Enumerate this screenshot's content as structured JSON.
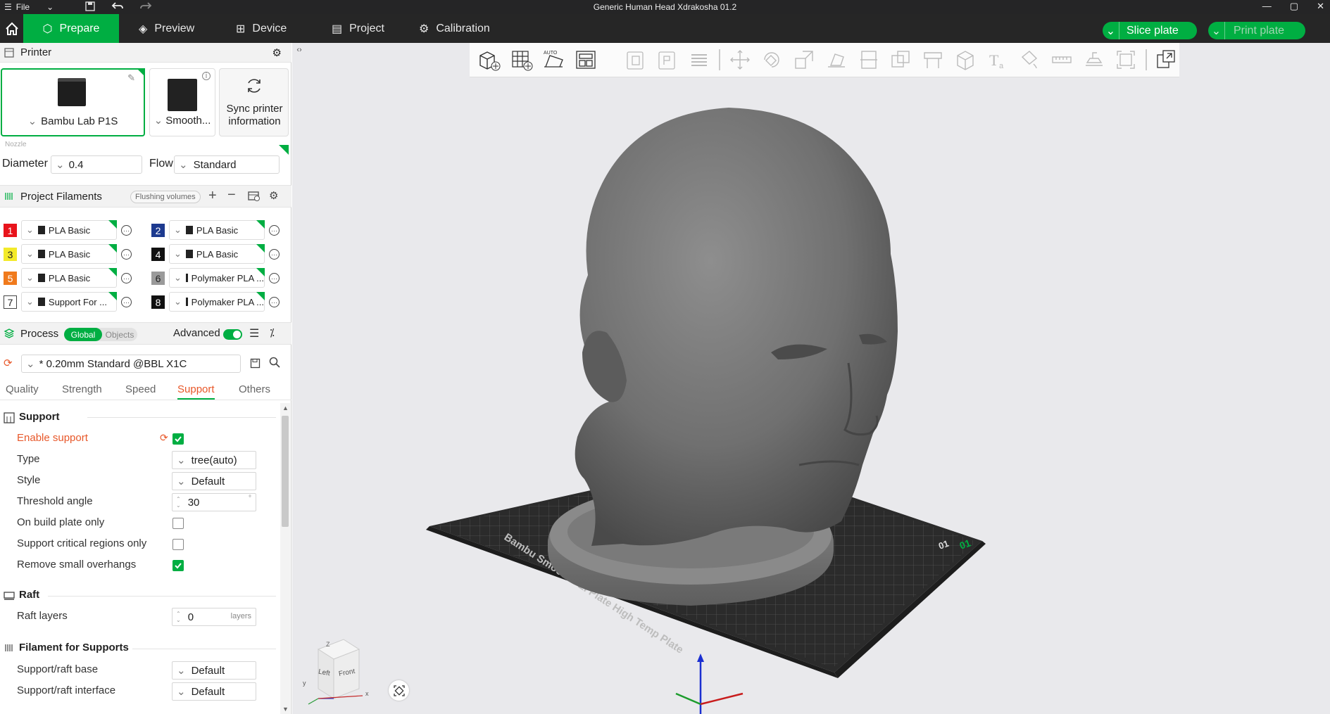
{
  "app": {
    "title": "Generic Human Head Xdrakosha 01.2",
    "file_menu": "File"
  },
  "nav": {
    "tabs": [
      {
        "label": "Prepare",
        "icon": "cube-icon",
        "active": true
      },
      {
        "label": "Preview",
        "icon": "layers-icon",
        "active": false
      },
      {
        "label": "Device",
        "icon": "device-icon",
        "active": false
      },
      {
        "label": "Project",
        "icon": "project-icon",
        "active": false
      },
      {
        "label": "Calibration",
        "icon": "calibration-icon",
        "active": false
      }
    ],
    "slice_button": "Slice plate",
    "print_button": "Print plate"
  },
  "printer": {
    "section_title": "Printer",
    "printer_name": "Bambu Lab P1S",
    "plate_name": "Smooth...",
    "sync_label": "Sync printer information",
    "nozzle_label": "Nozzle",
    "diameter_label": "Diameter",
    "diameter_value": "0.4",
    "flow_label": "Flow",
    "flow_value": "Standard"
  },
  "filaments": {
    "section_title": "Project Filaments",
    "flushing_label": "Flushing volumes",
    "items": [
      {
        "num": "1",
        "color": "#e8141c",
        "text_color": "#ffffff",
        "name": "PLA Basic"
      },
      {
        "num": "2",
        "color": "#1d3a8f",
        "text_color": "#ffffff",
        "name": "PLA Basic"
      },
      {
        "num": "3",
        "color": "#f3ea2a",
        "text_color": "#222222",
        "name": "PLA Basic"
      },
      {
        "num": "4",
        "color": "#111111",
        "text_color": "#ffffff",
        "name": "PLA Basic"
      },
      {
        "num": "5",
        "color": "#f07a1c",
        "text_color": "#ffffff",
        "name": "PLA Basic"
      },
      {
        "num": "6",
        "color": "#9a9a9a",
        "text_color": "#222222",
        "name": "Polymaker PLA ..."
      },
      {
        "num": "7",
        "color": "#ffffff",
        "text_color": "#222222",
        "name": "Support For ..."
      },
      {
        "num": "8",
        "color": "#111111",
        "text_color": "#ffffff",
        "name": "Polymaker PLA ..."
      }
    ]
  },
  "process": {
    "section_title": "Process",
    "global_label": "Global",
    "objects_label": "Objects",
    "advanced_label": "Advanced",
    "preset": "* 0.20mm Standard @BBL X1C",
    "tabs": [
      "Quality",
      "Strength",
      "Speed",
      "Support",
      "Others"
    ],
    "active_tab": "Support"
  },
  "support": {
    "title": "Support",
    "enable_label": "Enable support",
    "type_label": "Type",
    "type_value": "tree(auto)",
    "style_label": "Style",
    "style_value": "Default",
    "threshold_label": "Threshold angle",
    "threshold_value": "30",
    "threshold_unit": "°",
    "build_plate_label": "On build plate only",
    "critical_label": "Support critical regions only",
    "overhangs_label": "Remove small overhangs"
  },
  "raft": {
    "title": "Raft",
    "layers_label": "Raft layers",
    "layers_value": "0",
    "layers_unit": "layers"
  },
  "filament_supports": {
    "title": "Filament for Supports",
    "base_label": "Support/raft base",
    "base_value": "Default",
    "interface_label": "Support/raft interface",
    "interface_value": "Default"
  },
  "viewcube": {
    "left": "Left",
    "front": "Front",
    "z": "Z",
    "x": "x",
    "y": "y"
  },
  "plate": {
    "label": "Bambu Smooth PEI Plate High Temp Plate",
    "plate_number": "01"
  },
  "colors": {
    "accent": "#00ae42",
    "warning": "#e8582a"
  }
}
